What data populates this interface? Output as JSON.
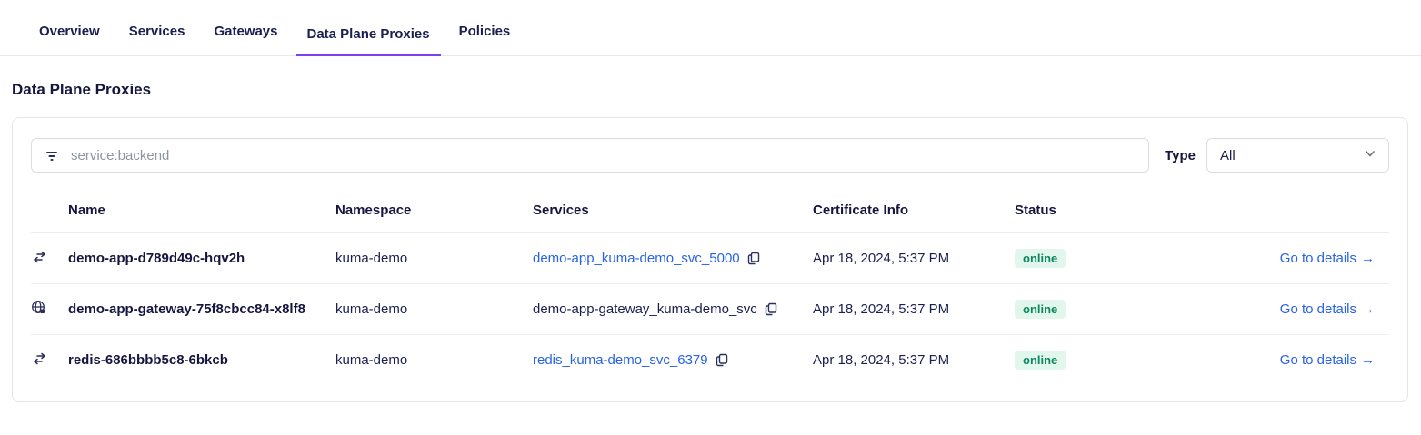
{
  "tabs": [
    {
      "label": "Overview",
      "active": false
    },
    {
      "label": "Services",
      "active": false
    },
    {
      "label": "Gateways",
      "active": false
    },
    {
      "label": "Data Plane Proxies",
      "active": true
    },
    {
      "label": "Policies",
      "active": false
    }
  ],
  "page": {
    "title": "Data Plane Proxies"
  },
  "filter": {
    "placeholder": "service:backend",
    "type_label": "Type",
    "type_value": "All"
  },
  "table": {
    "columns": [
      "Name",
      "Namespace",
      "Services",
      "Certificate Info",
      "Status"
    ],
    "details_arrow": "→",
    "rows": [
      {
        "icon": "proxy",
        "name": "demo-app-d789d49c-hqv2h",
        "namespace": "kuma-demo",
        "service": "demo-app_kuma-demo_svc_5000",
        "service_is_link": true,
        "certificate": "Apr 18, 2024, 5:37 PM",
        "status": "online",
        "details_label": "Go to details"
      },
      {
        "icon": "gateway",
        "name": "demo-app-gateway-75f8cbcc84-x8lf8",
        "namespace": "kuma-demo",
        "service": "demo-app-gateway_kuma-demo_svc",
        "service_is_link": false,
        "certificate": "Apr 18, 2024, 5:37 PM",
        "status": "online",
        "details_label": "Go to details"
      },
      {
        "icon": "proxy",
        "name": "redis-686bbbb5c8-6bkcb",
        "namespace": "kuma-demo",
        "service": "redis_kuma-demo_svc_6379",
        "service_is_link": true,
        "certificate": "Apr 18, 2024, 5:37 PM",
        "status": "online",
        "details_label": "Go to details"
      }
    ]
  },
  "colors": {
    "accent_purple": "#7d3ff2",
    "link_blue": "#2862e9",
    "status_online_bg": "#e1f7ed",
    "status_online_text": "#0e8560",
    "text_navy": "#14163f"
  }
}
